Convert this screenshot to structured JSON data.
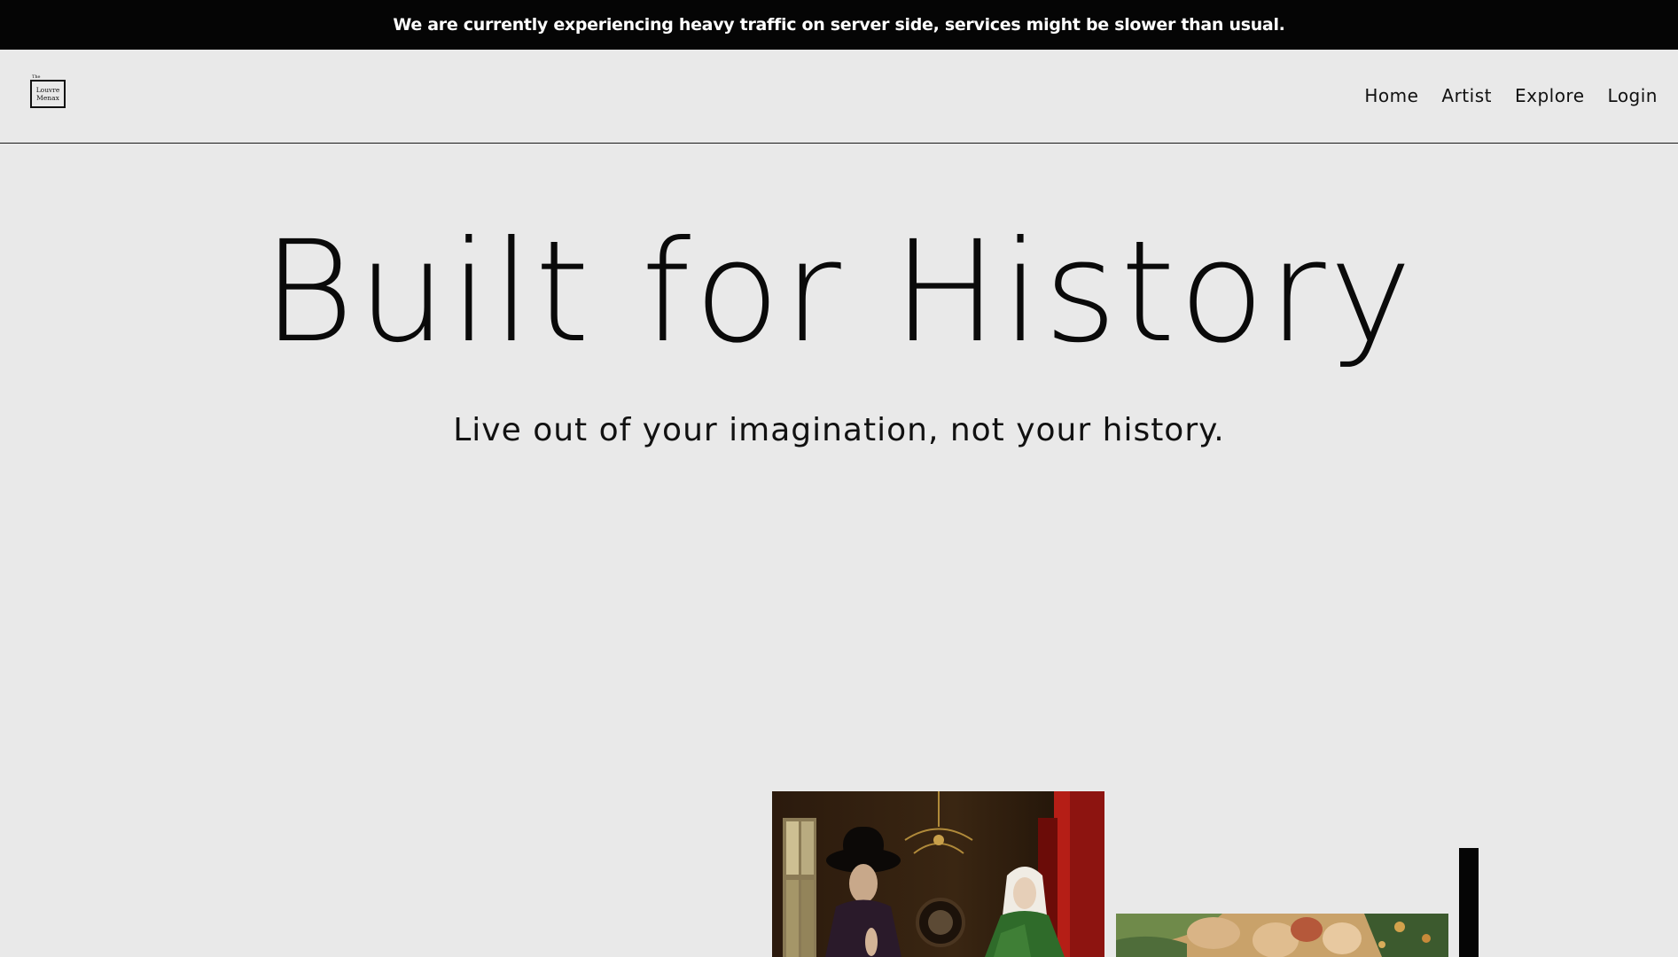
{
  "announcement": {
    "text": "We are currently experiencing heavy traffic on server side, services might be slower than usual."
  },
  "header": {
    "logo": {
      "small_text": "The",
      "line1": "Louvre",
      "line2": "Menax"
    },
    "nav": [
      {
        "label": "Home"
      },
      {
        "label": "Artist"
      },
      {
        "label": "Explore"
      },
      {
        "label": "Login"
      }
    ]
  },
  "hero": {
    "title": "Built for History",
    "subtitle": "Live out of your imagination, not your history."
  },
  "gallery": {
    "colors": {
      "background": "#e9e9e9",
      "announcement_bg": "#050505",
      "accent_bar": "#050505"
    }
  }
}
